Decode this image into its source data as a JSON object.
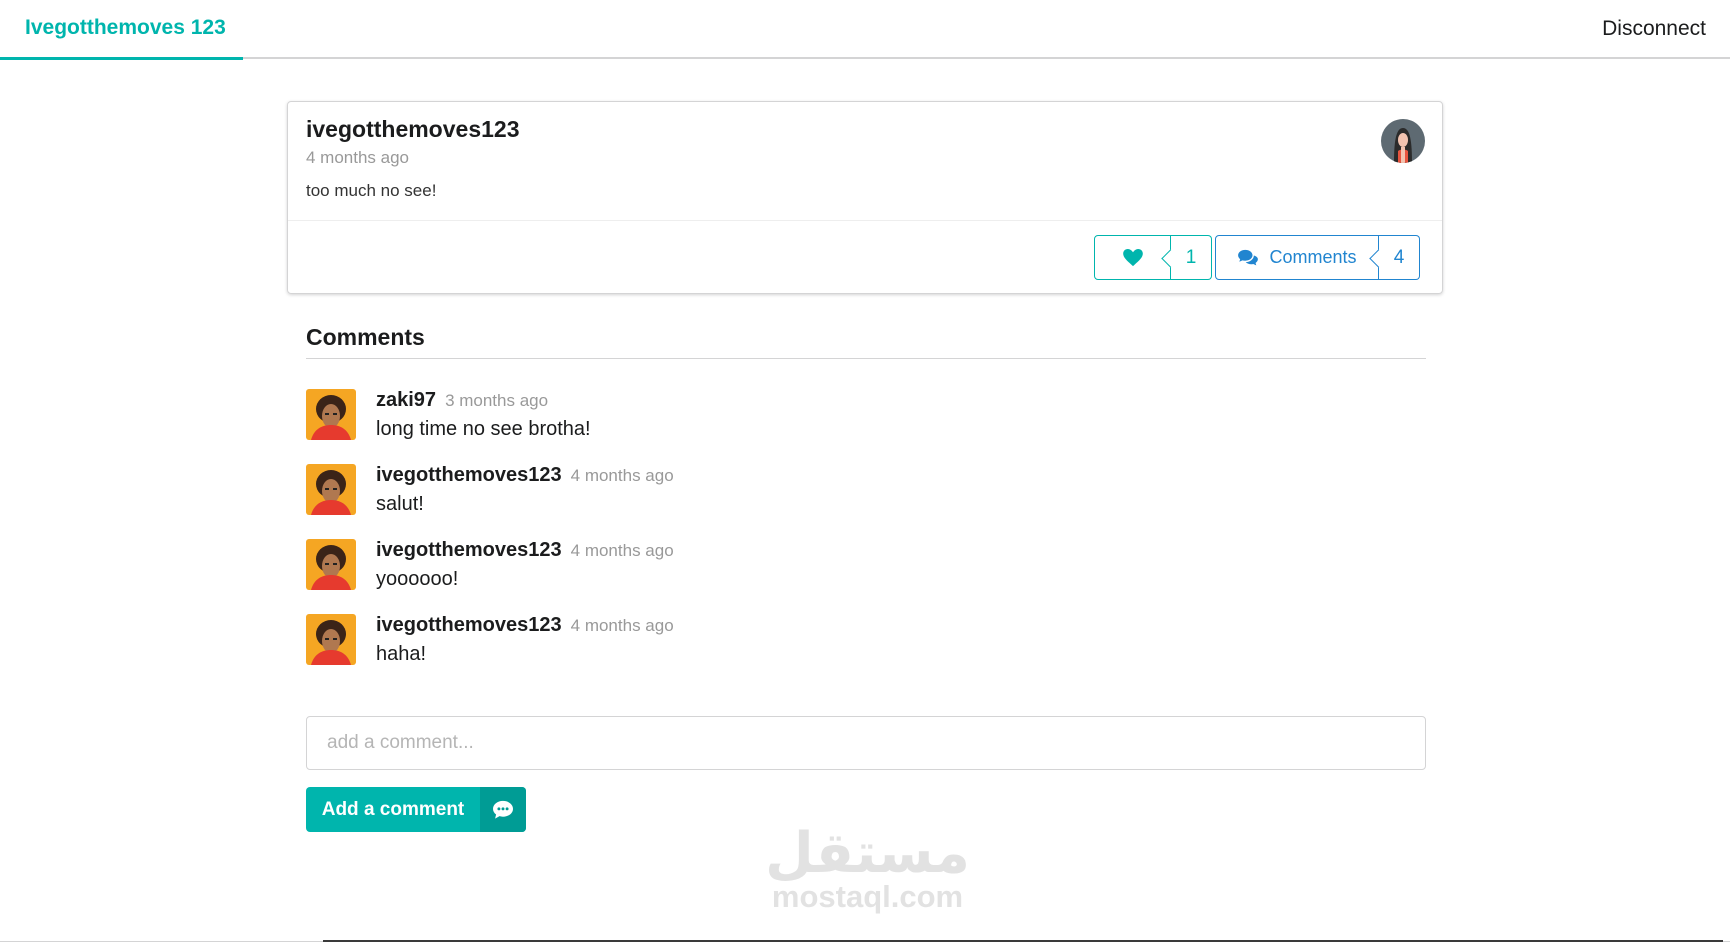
{
  "topbar": {
    "brand": "Ivegotthemoves 123",
    "disconnect": "Disconnect"
  },
  "post": {
    "author": "ivegotthemoves123",
    "time": "4 months ago",
    "text": "too much no see!",
    "like_count": "1",
    "comments_label": "Comments",
    "comments_count": "4"
  },
  "comments_section": {
    "title": "Comments",
    "items": [
      {
        "author": "zaki97",
        "time": "3 months ago",
        "text": "long time no see brotha!"
      },
      {
        "author": "ivegotthemoves123",
        "time": "4 months ago",
        "text": "salut!"
      },
      {
        "author": "ivegotthemoves123",
        "time": "4 months ago",
        "text": "yoooooo!"
      },
      {
        "author": "ivegotthemoves123",
        "time": "4 months ago",
        "text": "haha!"
      }
    ]
  },
  "form": {
    "placeholder": "add a comment...",
    "button_label": "Add a comment"
  },
  "watermark": {
    "arabic": "مستقل",
    "latin": "mostaql.com"
  },
  "colors": {
    "accent": "#00b5ad",
    "blue": "#2185d0"
  }
}
